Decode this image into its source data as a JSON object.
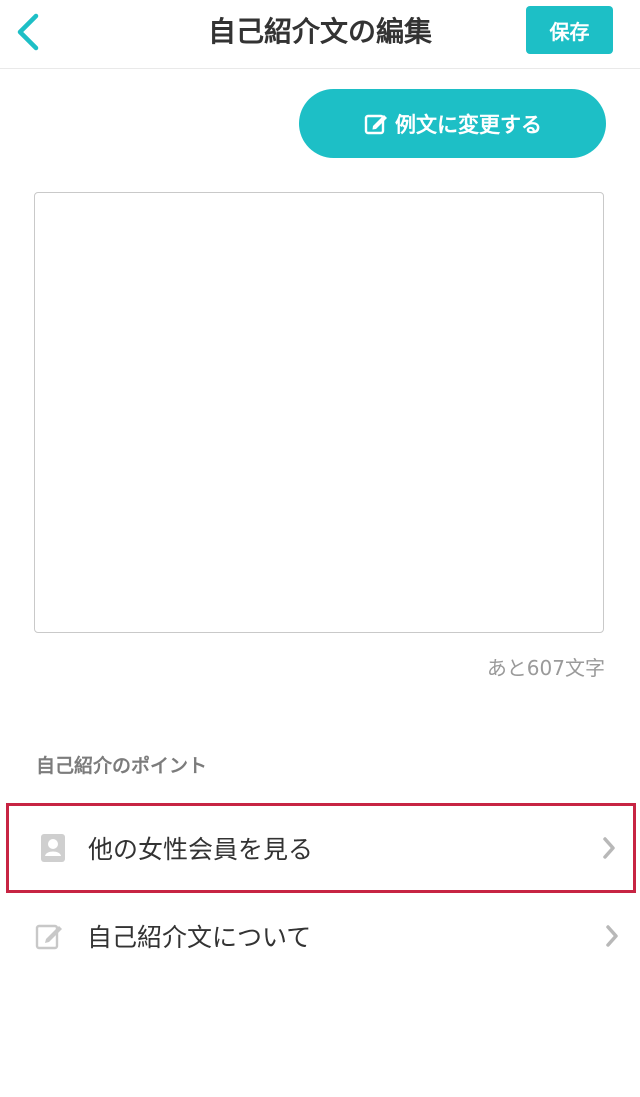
{
  "header": {
    "title": "自己紹介文の編集",
    "save_label": "保存",
    "back_icon": "chevron-left-icon"
  },
  "example_button": {
    "label": "例文に変更する",
    "icon": "edit-icon"
  },
  "editor": {
    "value": "",
    "remaining_label": "あと607文字"
  },
  "points": {
    "section_title": "自己紹介のポイント",
    "items": [
      {
        "label": "他の女性会員を見る",
        "icon": "profile-icon"
      },
      {
        "label": "自己紹介文について",
        "icon": "edit-icon"
      }
    ]
  },
  "colors": {
    "accent": "#1dbfc6",
    "highlight_border": "#c72443"
  }
}
